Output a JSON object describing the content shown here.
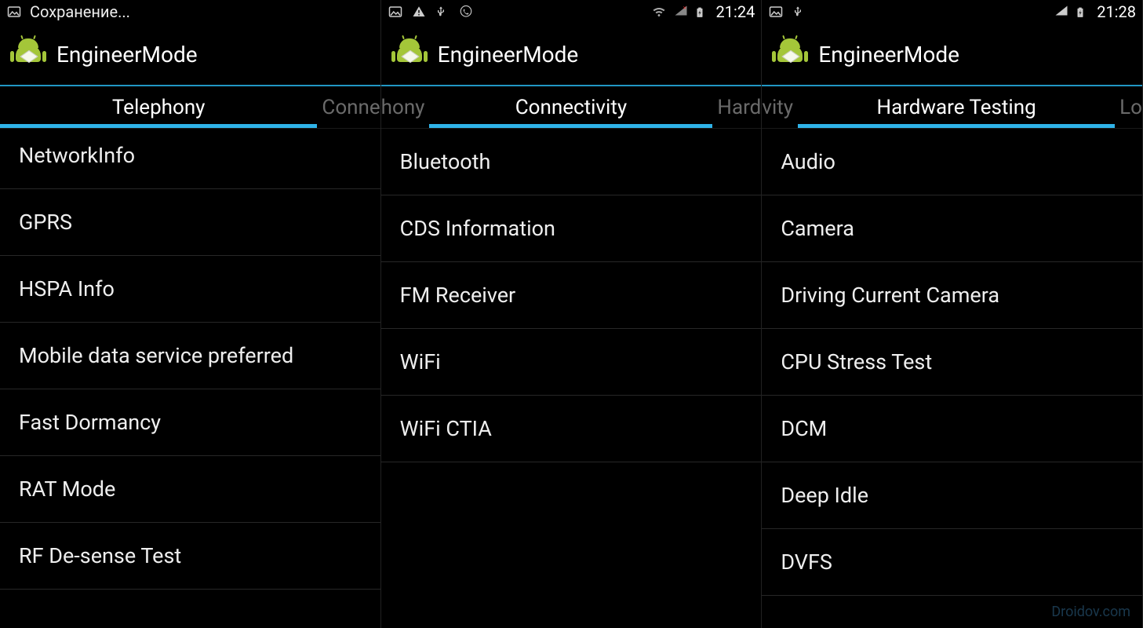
{
  "watermark": "Droidov.com",
  "phones": [
    {
      "status": {
        "left_text": "Сохранение...",
        "clock": ""
      },
      "appTitle": "EngineerMode",
      "tabs": {
        "left": "",
        "center": "Telephony",
        "right": "Conne"
      },
      "items": [
        "NetworkInfo",
        "GPRS",
        "HSPA Info",
        "Mobile data service preferred",
        "Fast Dormancy",
        "RAT Mode",
        "RF De-sense Test"
      ]
    },
    {
      "status": {
        "left_text": "",
        "clock": "21:24"
      },
      "appTitle": "EngineerMode",
      "tabs": {
        "left": "hony",
        "center": "Connectivity",
        "right": "Hard"
      },
      "items": [
        "Bluetooth",
        "CDS Information",
        "FM Receiver",
        "WiFi",
        "WiFi CTIA"
      ]
    },
    {
      "status": {
        "left_text": "",
        "clock": "21:28"
      },
      "appTitle": "EngineerMode",
      "tabs": {
        "left": "vity",
        "center": "Hardware Testing",
        "right": "Lo"
      },
      "items": [
        "Audio",
        "Camera",
        "Driving Current Camera",
        "CPU Stress Test",
        "DCM",
        "Deep Idle",
        "DVFS"
      ]
    }
  ]
}
